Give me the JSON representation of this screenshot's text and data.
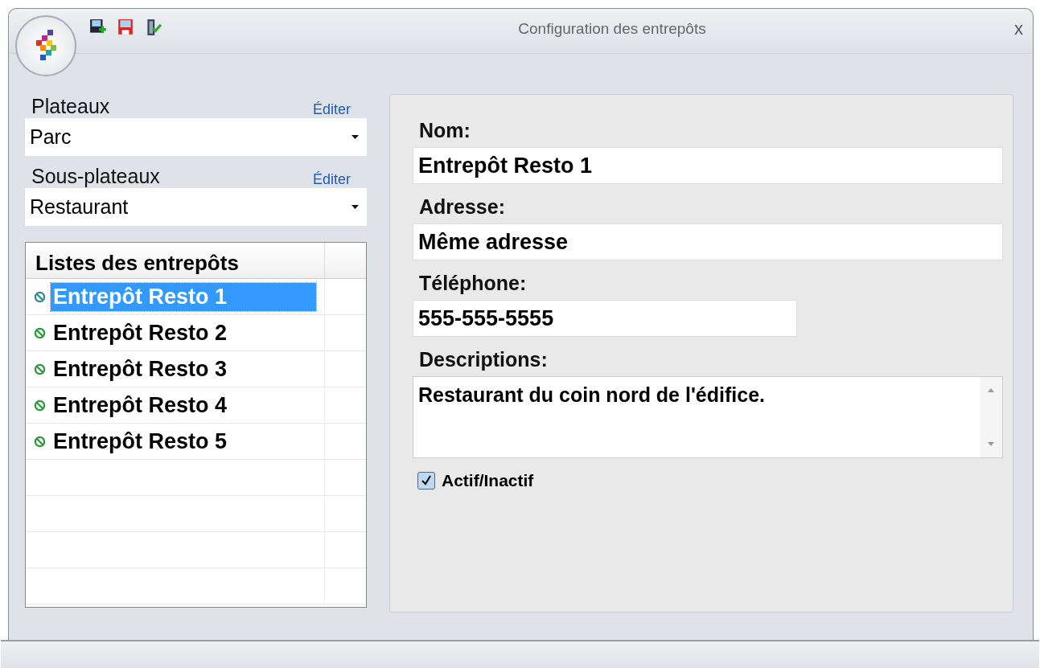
{
  "window": {
    "title": "Configuration des entrepôts",
    "close": "x"
  },
  "plateaux": {
    "label": "Plateaux",
    "edit": "Éditer",
    "value": "Parc"
  },
  "sous_plateaux": {
    "label": "Sous-plateaux",
    "edit": "Éditer",
    "value": "Restaurant"
  },
  "list": {
    "header": "Listes des entrepôts",
    "items": [
      {
        "label": "Entrepôt Resto 1",
        "selected": true
      },
      {
        "label": "Entrepôt Resto 2",
        "selected": false
      },
      {
        "label": "Entrepôt Resto 3",
        "selected": false
      },
      {
        "label": "Entrepôt Resto 4",
        "selected": false
      },
      {
        "label": "Entrepôt Resto 5",
        "selected": false
      }
    ]
  },
  "form": {
    "nom": {
      "label": "Nom:",
      "value": "Entrepôt Resto 1"
    },
    "adresse": {
      "label": "Adresse:",
      "value": "Même adresse"
    },
    "telephone": {
      "label": "Téléphone:",
      "value": "555-555-5555"
    },
    "descriptions": {
      "label": "Descriptions:",
      "value": "Restaurant du coin nord de l'édifice."
    },
    "actif": {
      "label": "Actif/Inactif",
      "checked": true
    }
  }
}
